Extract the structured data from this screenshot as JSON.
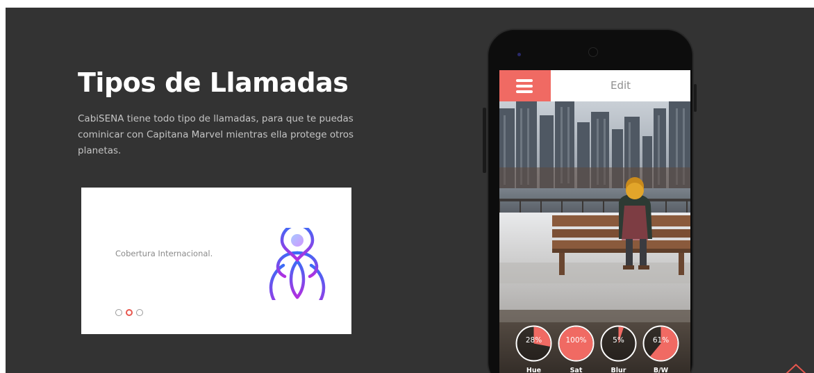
{
  "section": {
    "title": "Tipos de Llamadas",
    "description": "CabiSENA tiene todo tipo de llamadas, para que te puedas cominicar con Capitana Marvel mientras ella protege otros planetas."
  },
  "card": {
    "text": "Cobertura Internacional.",
    "icon": "globe-location-icon",
    "dots": 3,
    "active_dot": 2
  },
  "phone": {
    "appbar_title": "Edit",
    "controls": [
      {
        "value": "28%",
        "label": "Hue",
        "fraction": 0.28
      },
      {
        "value": "100%",
        "label": "Sat",
        "fraction": 1.0
      },
      {
        "value": "5%",
        "label": "Blur",
        "fraction": 0.05
      },
      {
        "value": "61%",
        "label": "B/W",
        "fraction": 0.61
      }
    ]
  },
  "colors": {
    "background": "#333333",
    "accent": "#f06a63",
    "gradient_start": "#3b6cf6",
    "gradient_end": "#b12fe0"
  }
}
